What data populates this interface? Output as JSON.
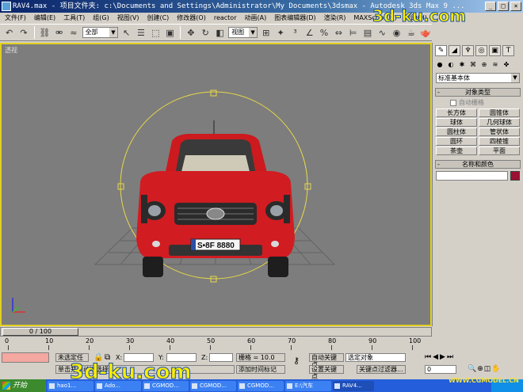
{
  "window": {
    "title": "RAV4.max    - 项目文件夹: c:\\Documents and Settings\\Administrator\\My Documents\\3dsmax    - Autodesk 3ds Max 9 ..."
  },
  "menu": [
    "文件(F)",
    "编辑(E)",
    "工具(T)",
    "组(G)",
    "视图(V)",
    "创建(C)",
    "修改器(O)",
    "reactor",
    "动画(A)",
    "图表编辑器(D)",
    "渲染(R)",
    "MAXScript(M)",
    "帮助(H)"
  ],
  "toolbar": {
    "selection_filter": "全部",
    "ref_coord": "视图"
  },
  "viewport": {
    "label": "透视",
    "license_plate": "S•8F 8880"
  },
  "command_panel": {
    "category_dropdown": "标准基本体",
    "object_type_header": "对象类型",
    "auto_grid_label": "自动栅格",
    "object_buttons": [
      "长方体",
      "圆锥体",
      "球体",
      "几何球体",
      "圆柱体",
      "管状体",
      "圆环",
      "四棱锥",
      "茶壶",
      "平面"
    ],
    "name_color_header": "名称和颜色",
    "accent_color": "#9b1033"
  },
  "timeline": {
    "frame_display": "0 / 100",
    "ticks": [
      "0",
      "10",
      "20",
      "30",
      "40",
      "50",
      "60",
      "70",
      "80",
      "90",
      "100"
    ]
  },
  "status": {
    "selection_status": "未选定任",
    "prompt": "单击并拖动以选择",
    "x_label": "X:",
    "y_label": "Y:",
    "z_label": "Z:",
    "grid_label": "栅格 = 10.0",
    "add_time_tag": "添加时间标记",
    "auto_key": "自动关键点",
    "set_key": "设置关键点",
    "selected_object": "选定对象",
    "key_filters": "关键点过滤器...",
    "frame_value": "0"
  },
  "taskbar": {
    "start": "开始",
    "tasks": [
      "hao1...",
      "Ado...",
      "CGMOD...",
      "CGMOD...",
      "CGMOD...",
      "E:\\汽车",
      "RAV4..."
    ],
    "tray": ""
  },
  "watermarks": {
    "top": "3d-ku.com",
    "bottom": "3d-ku.com",
    "corner": "WWW.CGMODEL.CN"
  }
}
